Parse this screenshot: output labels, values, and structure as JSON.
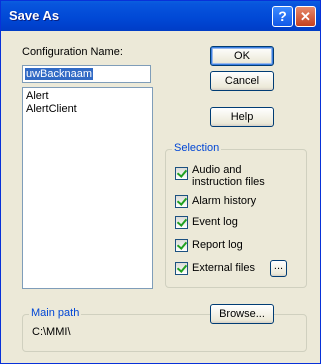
{
  "window": {
    "title": "Save As"
  },
  "titlebar": {
    "help_label": "?",
    "close_label": "✕"
  },
  "config": {
    "label": "Configuration Name:",
    "input_value": "uwBacknaam",
    "list_items": [
      "Alert",
      "AlertClient"
    ]
  },
  "buttons": {
    "ok": "OK",
    "cancel": "Cancel",
    "help": "Help",
    "browse": "Browse..."
  },
  "selection": {
    "title": "Selection",
    "options": [
      {
        "label_line1": "Audio and",
        "label_line2": "instruction files",
        "checked": true
      },
      {
        "label_line1": "Alarm history",
        "checked": true
      },
      {
        "label_line1": "Event log",
        "checked": true
      },
      {
        "label_line1": "Report log",
        "checked": true
      },
      {
        "label_line1": "External files",
        "checked": true
      }
    ],
    "ellipsis_label": "..."
  },
  "main_path": {
    "title": "Main path",
    "value": "C:\\MMI\\"
  },
  "colors": {
    "titlebar": "#0149d6",
    "group_title": "#0046d5",
    "face": "#ece9d8"
  }
}
